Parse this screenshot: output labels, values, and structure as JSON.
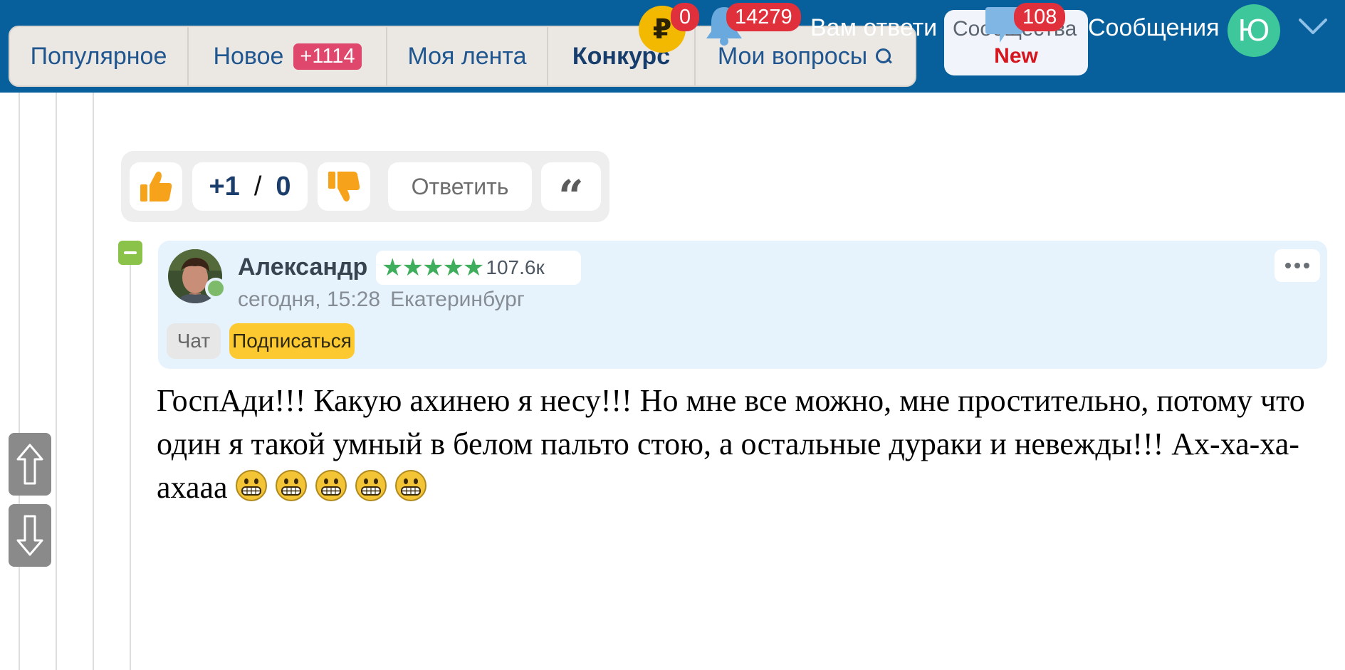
{
  "header": {
    "tabs": [
      {
        "label": "Популярное"
      },
      {
        "label": "Новое",
        "badge": "+1114"
      },
      {
        "label": "Моя лента"
      },
      {
        "label": "Конкурс"
      },
      {
        "label": "Мои вопросы"
      }
    ],
    "coin_symbol": "₽",
    "coin_count": "0",
    "bell_count": "14279",
    "notify_text": "Вам ответи",
    "messages_label": "Сообщества",
    "messages_new": "New",
    "messages_count": "108",
    "messages_text": "Сообщения",
    "user_initial": "Ю"
  },
  "vote": {
    "plus": "+1",
    "separator": "/",
    "minus": "0",
    "reply_label": "Ответить",
    "quote_glyph": "“"
  },
  "author": {
    "name": "Александр",
    "stars": "★★★★★",
    "rating": "107.6к",
    "time": "сегодня, 15:28",
    "city": "Екатеринбург",
    "chat_label": "Чат",
    "subscribe_label": "Подписаться"
  },
  "comment": {
    "text": "ГоспАди!!! Какую ахинею я несу!!! Но мне все можно, мне простительно, потому что один я такой умный в белом пальто стою, а остальные дураки и невежды!!! Ах-ха-ха-ахааа",
    "emoji_count": 5,
    "emoji_name": "grinning-face-icon"
  },
  "colors": {
    "header_bg": "#075f9b",
    "accent_blue": "#1f568f",
    "badge_red": "#e0303b",
    "badge_pink": "#e0476d",
    "thumb_orange": "#f7a21b",
    "star_green": "#3fae5c",
    "subscribe_yellow": "#fcc931"
  }
}
